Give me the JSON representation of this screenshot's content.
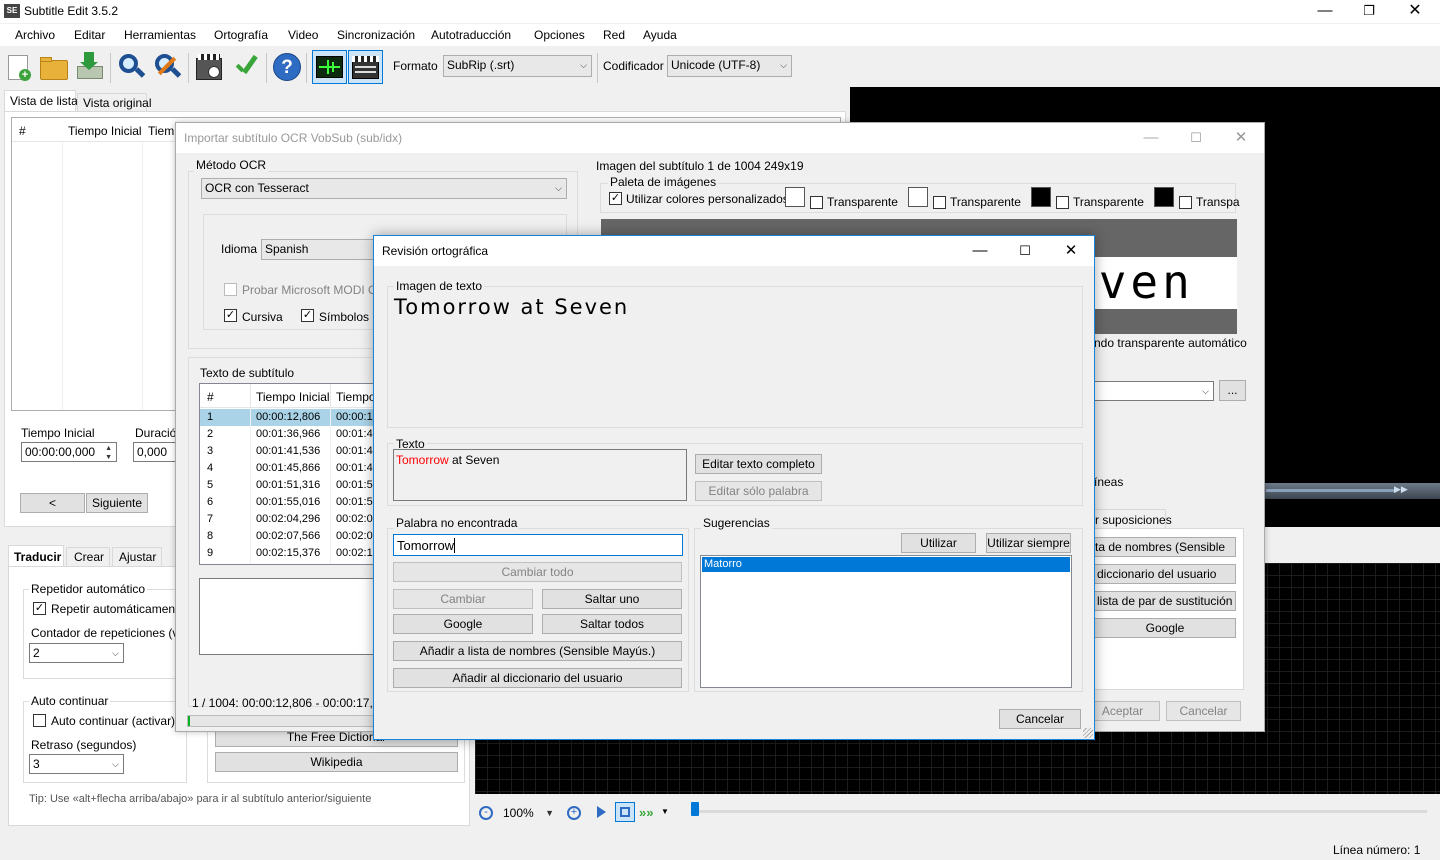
{
  "app": {
    "title": "Subtitle Edit 3.5.2",
    "logo": "SE",
    "menu": [
      "Archivo",
      "Editar",
      "Herramientas",
      "Ortografía",
      "Video",
      "Sincronización",
      "Autotraducción",
      "Opciones",
      "Red",
      "Ayuda"
    ],
    "toolbar": {
      "format_label": "Formato",
      "format_value": "SubRip (.srt)",
      "encoding_label": "Codificador",
      "encoding_value": "Unicode (UTF-8)"
    },
    "main_tabs": [
      "Vista de lista",
      "Vista original"
    ],
    "list_headers": [
      "#",
      "Tiempo Inicial",
      "Tiemp"
    ],
    "start_time_label": "Tiempo Inicial",
    "start_time_value": "00:00:00,000",
    "duration_label": "Duració",
    "duration_value": "0,000",
    "prev_button": "<",
    "next_button": "Siguiente",
    "bottom_tabs": [
      "Traducir",
      "Crear",
      "Ajustar"
    ],
    "auto_repeat_group": "Repetidor automático",
    "auto_repeat_check": "Repetir automáticamente",
    "repeat_count_label": "Contador de repeticiones (vec",
    "repeat_count_value": "2",
    "auto_continue_group": "Auto continuar",
    "auto_continue_check": "Auto continuar (activar)",
    "delay_label": "Retraso (segundos)",
    "delay_value": "3",
    "dictionary_button": "The Free Dictionar",
    "wikipedia_button": "Wikipedia",
    "tip": "Tip: Use «alt+flecha arriba/abajo» para ir al subtítulo anterior/siguiente",
    "zoom_value": "100%",
    "status": "Línea número: 1",
    "colors": {
      "accent": "#0078d7",
      "selection": "#aad3e8",
      "error_word": "#ff0000"
    }
  },
  "ocr_window": {
    "title": "Importar subtítulo OCR VobSub (sub/idx)",
    "method_group": "Método OCR",
    "method_value": "OCR con Tesseract",
    "language_label": "Idioma",
    "language_value": "Spanish",
    "modi_check": "Probar Microsoft MODI OCR",
    "italic_check": "Cursiva",
    "symbols_check": "Símbolos mu",
    "subtitle_text_label": "Texto de subtítulo",
    "table_headers": [
      "#",
      "Tiempo Inicial",
      "Tiempo"
    ],
    "rows": [
      {
        "n": "1",
        "start": "00:00:12,806",
        "end": "00:00:1"
      },
      {
        "n": "2",
        "start": "00:01:36,966",
        "end": "00:01:4"
      },
      {
        "n": "3",
        "start": "00:01:41,536",
        "end": "00:01:4"
      },
      {
        "n": "4",
        "start": "00:01:45,866",
        "end": "00:01:4"
      },
      {
        "n": "5",
        "start": "00:01:51,316",
        "end": "00:01:5"
      },
      {
        "n": "6",
        "start": "00:01:55,016",
        "end": "00:01:5"
      },
      {
        "n": "7",
        "start": "00:02:04,296",
        "end": "00:02:0"
      },
      {
        "n": "8",
        "start": "00:02:07,566",
        "end": "00:02:0"
      },
      {
        "n": "9",
        "start": "00:02:15,376",
        "end": "00:02:1"
      }
    ],
    "status_line": "1 / 1004: 00:00:12,806 - 00:00:17,78",
    "image_info": "Imagen del subtítulo 1 de 1004   249x19",
    "palette_group": "Paleta de imágenes",
    "custom_colors_check": "Utilizar colores personalizados",
    "transparent_labels": [
      "Transparente",
      "Transparente",
      "Transparente",
      "Transpa"
    ],
    "preview_text": "even",
    "auto_transparent": "ndo transparente automático",
    "lines_label": "íneas",
    "suppositions_tab": "r suposiciones",
    "right_buttons": [
      "ta de nombres (Sensible",
      "diccionario del usuario",
      "lista de par de sustitución",
      "Google"
    ],
    "browse_button": "...",
    "accept_button": "Aceptar",
    "cancel_button": "Cancelar"
  },
  "spell_dialog": {
    "title": "Revisión ortográfica",
    "image_group": "Imagen de texto",
    "image_text": "Tomorrow at Seven",
    "text_group": "Texto",
    "text_error_word": "Tomorrow",
    "text_rest": " at Seven",
    "edit_full_button": "Editar texto completo",
    "edit_word_button": "Editar sólo palabra",
    "not_found_group": "Palabra no encontrada",
    "word_value": "Tomorrow",
    "change_all_button": "Cambiar todo",
    "change_button": "Cambiar",
    "skip_one_button": "Saltar uno",
    "google_button": "Google",
    "skip_all_button": "Saltar todos",
    "add_names_button": "Añadir a lista de nombres (Sensible Mayús.)",
    "add_dict_button": "Añadir al diccionario del usuario",
    "suggestions_group": "Sugerencias",
    "use_button": "Utilizar",
    "use_always_button": "Utilizar siempre",
    "suggestions": [
      "Matorro"
    ],
    "cancel_button": "Cancelar"
  }
}
